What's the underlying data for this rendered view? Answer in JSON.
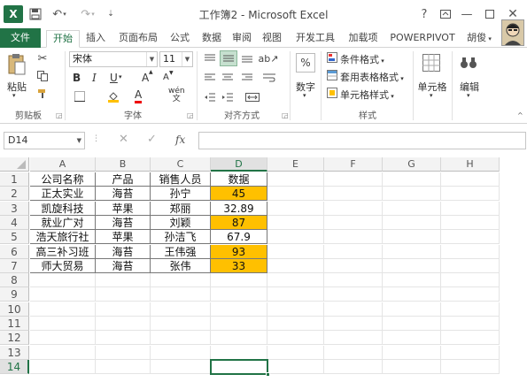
{
  "window": {
    "title": "工作簿2 - Microsoft Excel",
    "help_label": "?",
    "user_name": "胡俊"
  },
  "ribbon_tabs": [
    "文件",
    "开始",
    "插入",
    "页面布局",
    "公式",
    "数据",
    "审阅",
    "视图",
    "开发工具",
    "加载项",
    "POWERPIVOT"
  ],
  "ribbon": {
    "paste_label": "粘贴",
    "clipboard_label": "剪贴板",
    "font_name": "宋体",
    "font_size": "11",
    "font_label": "字体",
    "alignment_label": "对齐方式",
    "number_label": "数字",
    "percent_label": "%",
    "conditional_format": "条件格式",
    "table_format": "套用表格格式",
    "cell_style": "单元格样式",
    "styles_label": "样式",
    "cells_label": "单元格",
    "editing_label": "编辑",
    "bold": "B",
    "italic": "I",
    "underline": "U",
    "grow_font": "A",
    "shrink_font": "A",
    "font_color": "A",
    "wen": "wén"
  },
  "formula_bar": {
    "name_box": "D14",
    "fx": "fx",
    "formula": ""
  },
  "columns": [
    "A",
    "B",
    "C",
    "D",
    "E",
    "F",
    "G",
    "H"
  ],
  "rows": [
    "1",
    "2",
    "3",
    "4",
    "5",
    "6",
    "7",
    "8",
    "9",
    "10",
    "11",
    "12",
    "13",
    "14"
  ],
  "table": {
    "header": [
      "公司名称",
      "产品",
      "销售人员",
      "数据"
    ],
    "rows": [
      [
        "正太实业",
        "海苔",
        "孙宁",
        "45"
      ],
      [
        "凯旋科技",
        "苹果",
        "郑丽",
        "32.89"
      ],
      [
        "就业广对",
        "海苔",
        "刘颖",
        "87"
      ],
      [
        "浩天旅行社",
        "苹果",
        "孙洁飞",
        "67.9"
      ],
      [
        "高三补习班",
        "海苔",
        "王伟强",
        "93"
      ],
      [
        "师大贸易",
        "海苔",
        "张伟",
        "33"
      ]
    ],
    "highlighted_rows": [
      0,
      2,
      4,
      5
    ],
    "highlight_color": "#ffc000"
  },
  "colors": {
    "accent": "#217346"
  }
}
